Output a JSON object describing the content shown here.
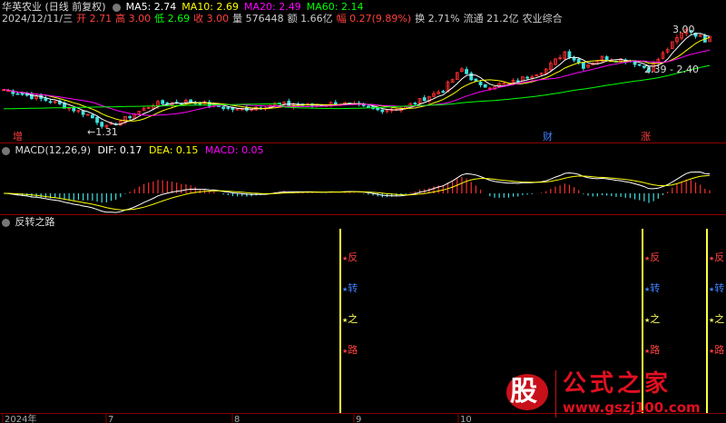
{
  "header": {
    "stock": "华英农业 (日线 前复权)",
    "ma": [
      {
        "label": "MA5: 2.74",
        "color": "#ffffff"
      },
      {
        "label": "MA10: 2.69",
        "color": "#ffff00"
      },
      {
        "label": "MA20: 2.49",
        "color": "#ff00ff"
      },
      {
        "label": "MA60: 2.14",
        "color": "#00ff00"
      }
    ],
    "quote": [
      {
        "text": "2024/12/11/三",
        "color": "#cccccc"
      },
      {
        "text": "开 2.71",
        "color": "#ff4040"
      },
      {
        "text": "高 3.00",
        "color": "#ff4040"
      },
      {
        "text": "低 2.69",
        "color": "#00ff00"
      },
      {
        "text": "收 3.00",
        "color": "#ff4040"
      },
      {
        "text": "量 576448",
        "color": "#cccccc"
      },
      {
        "text": "额 1.66亿",
        "color": "#cccccc"
      },
      {
        "text": "幅 0.27(9.89%)",
        "color": "#ff4040"
      },
      {
        "text": "换 2.71%",
        "color": "#cccccc"
      },
      {
        "text": "流通 21.2亿",
        "color": "#cccccc"
      },
      {
        "text": "农业综合",
        "color": "#cccccc"
      }
    ]
  },
  "price_chart": {
    "annotations": {
      "high": "3.00",
      "low": "1.31",
      "range": "2.39 - 2.40"
    },
    "markers": [
      {
        "text": "增",
        "color": "#ff4040"
      },
      {
        "text": "财",
        "color": "#4080ff"
      },
      {
        "text": "涨",
        "color": "#ff4040"
      }
    ]
  },
  "macd_panel": {
    "title": "MACD(12,26,9)",
    "dif": "DIF: 0.17",
    "dea": "DEA: 0.15",
    "macd": "MACD: 0.05"
  },
  "indicator_panel": {
    "title": "反转之路",
    "signal_chars": [
      {
        "text": "反",
        "color": "#ff4040"
      },
      {
        "text": "转",
        "color": "#4080ff"
      },
      {
        "text": "之",
        "color": "#ffff60"
      },
      {
        "text": "路",
        "color": "#ff4040"
      }
    ]
  },
  "x_axis": {
    "labels": [
      "2024年",
      "7",
      "8",
      "9",
      "10"
    ]
  },
  "watermark": {
    "brand": "股",
    "name": "公式之家",
    "url": "www.gszj100.com"
  }
}
